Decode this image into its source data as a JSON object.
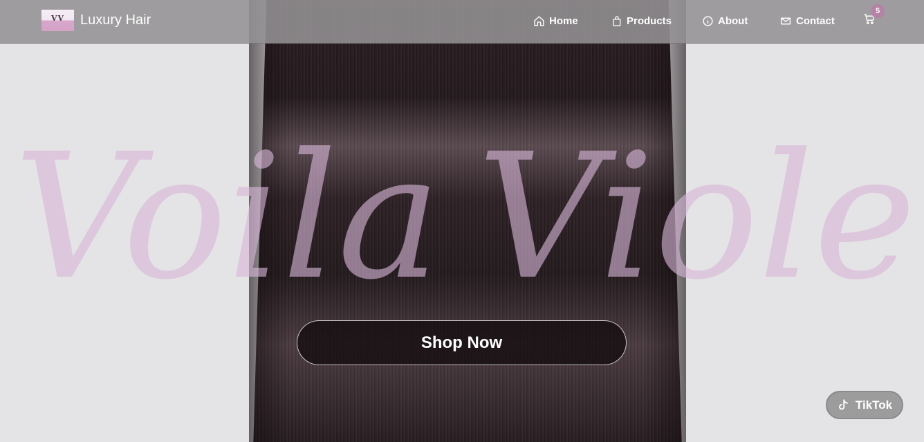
{
  "brand": {
    "logo_text": "VV",
    "name": "Luxury Hair"
  },
  "nav": {
    "home": {
      "label": "Home",
      "icon": "home-icon"
    },
    "products": {
      "label": "Products",
      "icon": "shopping-bag-icon"
    },
    "about": {
      "label": "About",
      "icon": "info-icon"
    },
    "contact": {
      "label": "Contact",
      "icon": "mail-icon"
    }
  },
  "cart": {
    "icon": "cart-icon",
    "count": "5"
  },
  "hero": {
    "watermark_word1": "Voila",
    "watermark_word2": "Violet",
    "cta_label": "Shop Now"
  },
  "social": {
    "tiktok_label": "TikTok",
    "icon": "tiktok-icon"
  },
  "colors": {
    "navbar": "#949294",
    "accent": "#b483a5",
    "watermark": "#d7b6d6",
    "hero_background": "#e4e3e5",
    "cta_background": "#120b0e"
  }
}
